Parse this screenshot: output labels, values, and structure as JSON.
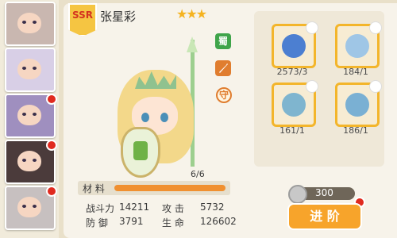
{
  "hero": {
    "rarity": "SSR",
    "name": "张星彩",
    "stars": "★★★",
    "faction_tag": "蜀",
    "role_tag": "守"
  },
  "materials": {
    "label": "材 料",
    "count": "6/6",
    "fill": 1.0
  },
  "stats": {
    "power_label": "战斗力",
    "power_value": "14211",
    "attack_label": "攻 击",
    "attack_value": "5732",
    "defense_label": "防 御",
    "defense_value": "3791",
    "hp_label": "生 命",
    "hp_value": "126602"
  },
  "equipment": [
    {
      "icon": "potion-icon",
      "count": "2573/3"
    },
    {
      "icon": "snowflake-icon",
      "count": "184/1"
    },
    {
      "icon": "sphere-icon",
      "count": "161/1"
    },
    {
      "icon": "crescent-moon-icon",
      "count": "186/1"
    }
  ],
  "currency": {
    "value": "300"
  },
  "advance_button": {
    "label": "进 阶"
  },
  "colors": {
    "accent_orange": "#f09030",
    "gold_border": "#f3b52b",
    "shu_green": "#3fa44a",
    "red_dot": "#e02a1f"
  }
}
